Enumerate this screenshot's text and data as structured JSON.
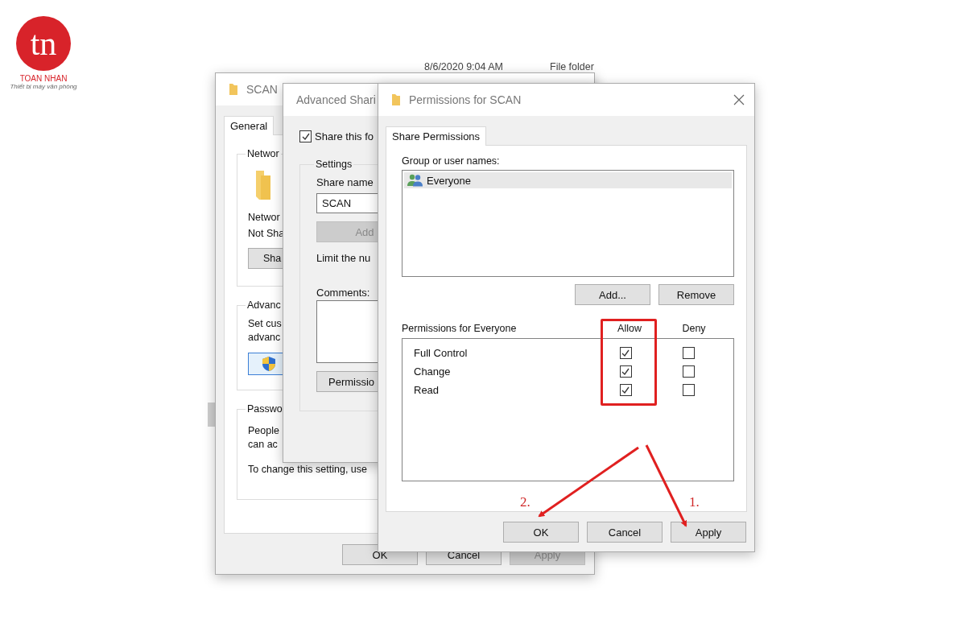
{
  "logo": {
    "mark": "tn",
    "name": "TOAN NHAN",
    "tagline": "Thiết bị máy văn phòng"
  },
  "explorer_background": {
    "date_modified": "8/6/2020 9:04 AM",
    "type": "File folder"
  },
  "properties_window": {
    "title": "SCAN",
    "tabs": [
      {
        "label": "General",
        "selected": true
      }
    ],
    "network_group": {
      "legend": "Networ",
      "lines": [
        "Networ",
        "Not Sha"
      ],
      "button": "Sha"
    },
    "advanced_group": {
      "legend": "Advanc",
      "lines": [
        "Set cus",
        "advanc"
      ]
    },
    "password_group": {
      "legend": "Passwo",
      "lines": [
        "People",
        "can ac"
      ],
      "note": "To change this setting, use"
    },
    "buttons": [
      {
        "label": "OK",
        "disabled": false
      },
      {
        "label": "Cancel",
        "disabled": false
      },
      {
        "label": "Apply",
        "disabled": true
      }
    ]
  },
  "advanced_sharing_window": {
    "title": "Advanced Shari",
    "share_checkbox": {
      "label": "Share this fo",
      "checked": true
    },
    "settings_legend": "Settings",
    "share_name_label": "Share name",
    "share_name_value": "SCAN",
    "add_button": {
      "label": "Add",
      "disabled": true
    },
    "limit_text": "Limit the nu",
    "comments_label": "Comments:",
    "permissions_button": "Permissio"
  },
  "permissions_window": {
    "title": "Permissions for SCAN",
    "tabs": [
      {
        "label": "Share Permissions",
        "selected": true
      }
    ],
    "group_label": "Group or user names:",
    "users": [
      {
        "name": "Everyone",
        "selected": true
      }
    ],
    "user_buttons": [
      "Add...",
      "Remove"
    ],
    "permissions_label": "Permissions for Everyone",
    "columns": [
      "Allow",
      "Deny"
    ],
    "permissions": [
      {
        "name": "Full Control",
        "allow": true,
        "deny": false
      },
      {
        "name": "Change",
        "allow": true,
        "deny": false
      },
      {
        "name": "Read",
        "allow": true,
        "deny": false
      }
    ],
    "buttons": [
      "OK",
      "Cancel",
      "Apply"
    ]
  },
  "annotations": {
    "steps": [
      {
        "label": "2."
      },
      {
        "label": "1."
      }
    ]
  }
}
